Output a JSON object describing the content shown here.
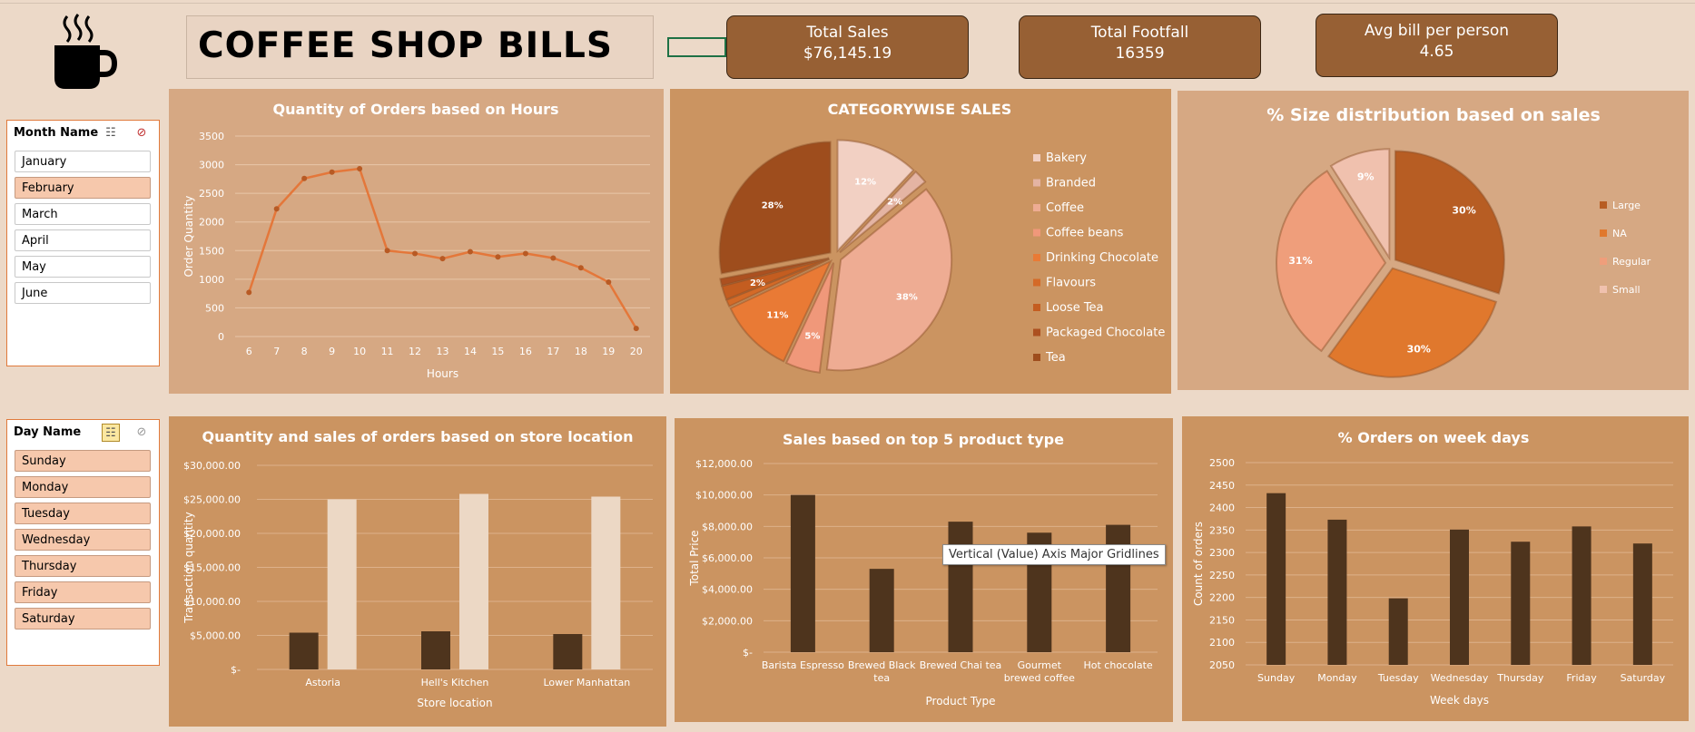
{
  "header": {
    "title": "COFFEE SHOP BILLS",
    "kpis": [
      {
        "label": "Total Sales",
        "value": "$76,145.19"
      },
      {
        "label": "Total Footfall",
        "value": "16359"
      },
      {
        "label": "Avg bill per person",
        "value": "4.65"
      }
    ]
  },
  "slicers": {
    "month": {
      "title": "Month Name",
      "items": [
        {
          "label": "January",
          "selected": false
        },
        {
          "label": "February",
          "selected": true
        },
        {
          "label": "March",
          "selected": false
        },
        {
          "label": "April",
          "selected": false
        },
        {
          "label": "May",
          "selected": false
        },
        {
          "label": "June",
          "selected": false
        }
      ]
    },
    "day": {
      "title": "Day Name",
      "items": [
        {
          "label": "Sunday",
          "selected": true
        },
        {
          "label": "Monday",
          "selected": true
        },
        {
          "label": "Tuesday",
          "selected": true
        },
        {
          "label": "Wednesday",
          "selected": true
        },
        {
          "label": "Thursday",
          "selected": true
        },
        {
          "label": "Friday",
          "selected": true
        },
        {
          "label": "Saturday",
          "selected": true
        }
      ]
    }
  },
  "tooltip": "Vertical (Value) Axis Major Gridlines",
  "colors": {
    "background": "#ecd9c8",
    "panel_light": "#d6a883",
    "panel_dark": "#cb9461",
    "kpi": "#976034",
    "line": "#e4773a",
    "bar_dark": "#4e341d",
    "bar_light": "#ecd8c5"
  },
  "chart_data": [
    {
      "id": "hours",
      "type": "line",
      "title": "Quantity of Orders based on Hours",
      "xlabel": "Hours",
      "ylabel": "Order Quantity",
      "x": [
        6,
        7,
        8,
        9,
        10,
        11,
        12,
        13,
        14,
        15,
        16,
        17,
        18,
        19,
        20
      ],
      "values": [
        770,
        2230,
        2760,
        2870,
        2930,
        1500,
        1450,
        1360,
        1480,
        1390,
        1450,
        1370,
        1200,
        950,
        140
      ],
      "ylim": [
        0,
        3500
      ],
      "yticks": [
        "0",
        "500",
        "1000",
        "1500",
        "2000",
        "2500",
        "3000",
        "3500"
      ],
      "grid": true
    },
    {
      "id": "category",
      "type": "pie",
      "title": "CATEGORYWISE SALES",
      "legend_position": "right",
      "labels": [
        "Bakery",
        "Branded",
        "Coffee",
        "Coffee beans",
        "Drinking Chocolate",
        "Flavours",
        "Loose Tea",
        "Packaged Chocolate",
        "Tea"
      ],
      "values": [
        12,
        2,
        38,
        5,
        11,
        1,
        2,
        1,
        28
      ],
      "data_labels": [
        "12%",
        "2%",
        "38%",
        "5%",
        "11%",
        "",
        "2%",
        "",
        "28%"
      ],
      "colors": [
        "#f2d0c3",
        "#e4b4a3",
        "#eeac93",
        "#f0987a",
        "#e97a35",
        "#d46a27",
        "#c45d20",
        "#ac5020",
        "#9e4d1d"
      ]
    },
    {
      "id": "size",
      "type": "pie",
      "title": "% Size distribution based on sales",
      "legend_position": "right",
      "labels": [
        "Large",
        "NA",
        "Regular",
        "Small"
      ],
      "values": [
        30,
        30,
        31,
        9
      ],
      "data_labels": [
        "30%",
        "30%",
        "31%",
        "9%"
      ],
      "colors": [
        "#b75d23",
        "#e0782d",
        "#ef9e7b",
        "#f0c1ae"
      ]
    },
    {
      "id": "location",
      "type": "bar",
      "title": "Quantity and sales of orders based on store location",
      "xlabel": "Store location",
      "ylabel": "Transaction quantity",
      "categories": [
        "Astoria",
        "Hell's Kitchen",
        "Lower Manhattan"
      ],
      "series": [
        {
          "values": [
            5400,
            5600,
            5200
          ]
        },
        {
          "values": [
            25000,
            25800,
            25400
          ]
        }
      ],
      "ylim": [
        0,
        30000
      ],
      "yticks": [
        "$-",
        "$5,000.00",
        "$10,000.00",
        "$15,000.00",
        "$20,000.00",
        "$25,000.00",
        "$30,000.00"
      ],
      "grid": true
    },
    {
      "id": "products",
      "type": "bar",
      "title": "Sales based on top 5 product type",
      "xlabel": "Product Type",
      "ylabel": "Total Price",
      "categories": [
        [
          "Barista Espresso"
        ],
        [
          "Brewed Black",
          "tea"
        ],
        [
          "Brewed Chai tea"
        ],
        [
          "Gourmet",
          "brewed coffee"
        ],
        [
          "Hot chocolate"
        ]
      ],
      "values": [
        10000,
        5300,
        8300,
        7600,
        8100
      ],
      "ylim": [
        0,
        12000
      ],
      "yticks": [
        "$-",
        "$2,000.00",
        "$4,000.00",
        "$6,000.00",
        "$8,000.00",
        "$10,000.00",
        "$12,000.00"
      ],
      "grid": true
    },
    {
      "id": "weekdays",
      "type": "bar",
      "title": "% Orders on week days",
      "xlabel": "Week days",
      "ylabel": "Count of orders",
      "categories": [
        "Sunday",
        "Monday",
        "Tuesday",
        "Wednesday",
        "Thursday",
        "Friday",
        "Saturday"
      ],
      "values": [
        2432,
        2373,
        2198,
        2351,
        2324,
        2358,
        2320
      ],
      "ylim": [
        2050,
        2500
      ],
      "yticks": [
        "2050",
        "2100",
        "2150",
        "2200",
        "2250",
        "2300",
        "2350",
        "2400",
        "2450",
        "2500"
      ],
      "grid": true
    }
  ]
}
